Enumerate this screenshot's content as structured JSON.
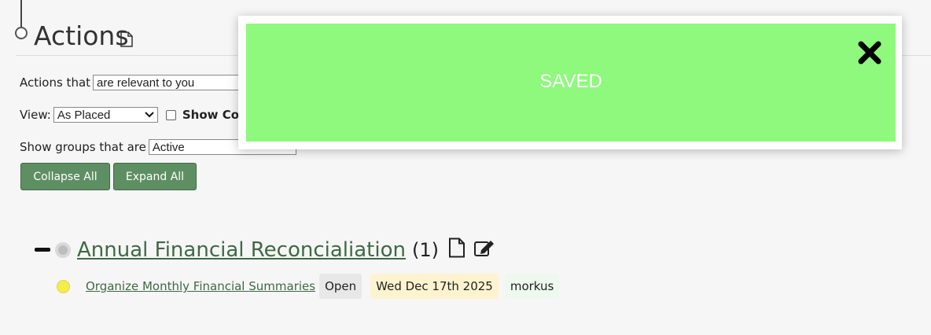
{
  "section": {
    "title": "Actions"
  },
  "filters": {
    "actions_label": "Actions that",
    "actions_value": "are relevant to you",
    "view_label": "View:",
    "view_value": "As Placed",
    "show_partial_label": "Show Co",
    "groups_label": "Show groups that are",
    "groups_value": "Active"
  },
  "buttons": {
    "collapse_all": "Collapse All",
    "expand_all": "Expand All"
  },
  "group": {
    "name": "Annual Financial Reconcialiation",
    "count": "(1)",
    "items": [
      {
        "title": "Organize Monthly Financial Summaries",
        "status": "Open",
        "date": "Wed Dec 17th 2025",
        "assignee": "morkus"
      }
    ]
  },
  "notification": {
    "message": "SAVED"
  },
  "colors": {
    "accent_green": "#5d8f63",
    "link_green": "#3e6a45",
    "toast_green": "#8ef97c",
    "status_dot_yellow": "#f5ec4d"
  }
}
